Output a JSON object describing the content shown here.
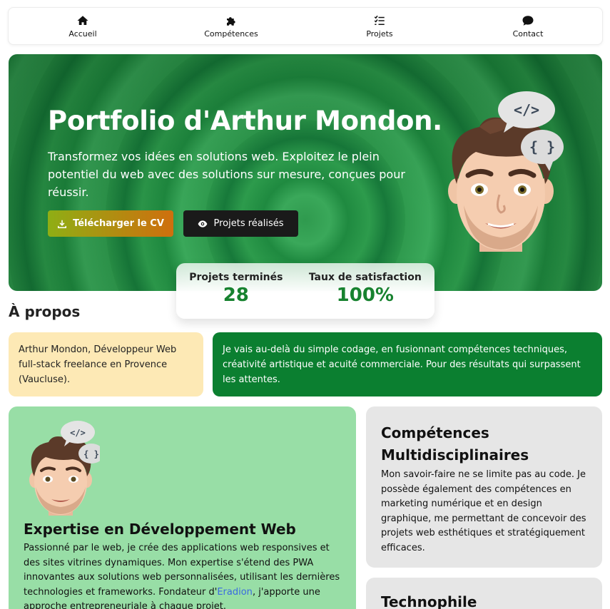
{
  "nav": {
    "items": [
      {
        "label": "Accueil",
        "icon": "home-icon"
      },
      {
        "label": "Compétences",
        "icon": "puzzle-icon"
      },
      {
        "label": "Projets",
        "icon": "list-check-icon"
      },
      {
        "label": "Contact",
        "icon": "chat-bubble-icon"
      }
    ]
  },
  "hero": {
    "title": "Portfolio d'Arthur Mondon.",
    "subtitle": "Transformez vos idées en solutions web. Exploitez le plein potentiel du web avec des solutions sur mesure, conçues pour réussir.",
    "btn_cv": "Télécharger le CV",
    "btn_projects": "Projets réalisés",
    "bubble_code": "</>",
    "bubble_braces": "{ }"
  },
  "stats": [
    {
      "label": "Projets terminés",
      "value": "28"
    },
    {
      "label": "Taux de satisfaction",
      "value": "100%"
    }
  ],
  "about": {
    "heading": "À propos",
    "intro": "Arthur Mondon, Développeur Web full-stack freelance en Provence (Vaucluse).",
    "pitch": "Je vais au-delà du simple codage, en fusionnant compétences techniques, créativité artistique et acuité commerciale. Pour des résultats qui surpassent les attentes."
  },
  "expertise": {
    "title": "Expertise en Développement Web",
    "text_before": "Passionné par le web, je crée des applications web responsives et des sites vitrines dynamiques. Mon expertise s'étend des PWA innovantes aux solutions web personnalisées, utilisant les dernières technologies et frameworks. Fondateur d'",
    "link": "Eradion",
    "text_after": ", j'apporte une approche entrepreneuriale à chaque projet."
  },
  "competences": {
    "title": "Compétences Multidisciplinaires",
    "text": "Mon savoir-faire ne se limite pas au code. Je possède également des compétences en marketing numérique et en design graphique, me permettant de concevoir des projets web esthétiques et stratégiquement efficaces."
  },
  "technophile": {
    "title": "Technophile"
  },
  "colors": {
    "accent_green": "#0b7f30",
    "stat_green": "#17822f",
    "card_yellow": "#fde9b5",
    "card_mint": "#98dea6",
    "card_gray": "#e6e6e6",
    "link_blue": "#3a6be0"
  }
}
